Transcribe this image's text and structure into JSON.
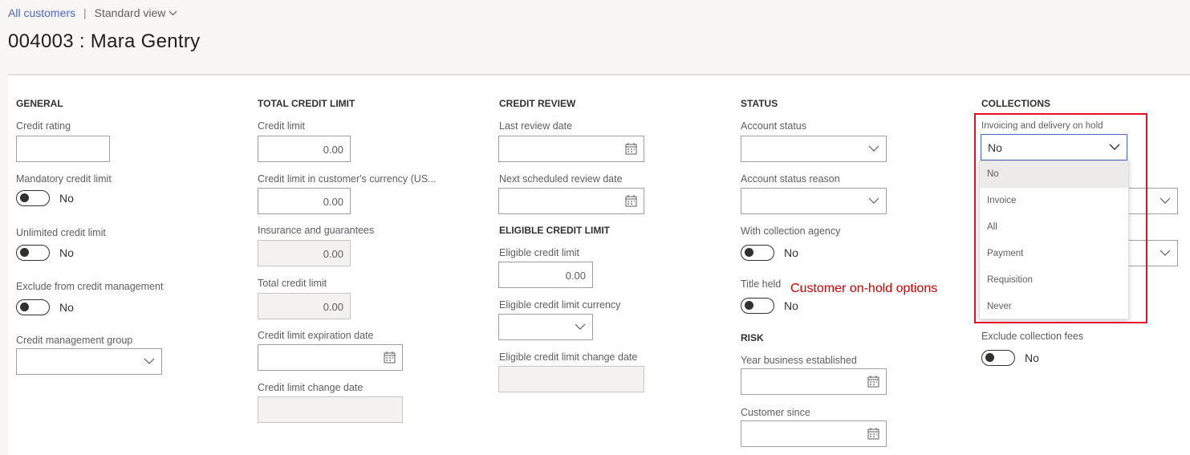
{
  "breadcrumb": {
    "link": "All customers",
    "separator": "|",
    "view": "Standard view"
  },
  "title": "004003 : Mara Gentry",
  "sections": {
    "general": {
      "title": "GENERAL",
      "credit_rating_label": "Credit rating",
      "mandatory_label": "Mandatory credit limit",
      "mandatory_value": "No",
      "unlimited_label": "Unlimited credit limit",
      "unlimited_value": "No",
      "exclude_label": "Exclude from credit management",
      "exclude_value": "No",
      "group_label": "Credit management group"
    },
    "total_credit_limit": {
      "title": "TOTAL CREDIT LIMIT",
      "credit_limit_label": "Credit limit",
      "credit_limit_value": "0.00",
      "currency_label": "Credit limit in customer's currency (US...",
      "currency_value": "0.00",
      "insurance_label": "Insurance and guarantees",
      "insurance_value": "0.00",
      "total_label": "Total credit limit",
      "total_value": "0.00",
      "expiration_label": "Credit limit expiration date",
      "change_date_label": "Credit limit change date"
    },
    "credit_review": {
      "title": "CREDIT REVIEW",
      "last_review_label": "Last review date",
      "next_review_label": "Next scheduled review date"
    },
    "eligible_credit_limit": {
      "title": "ELIGIBLE CREDIT LIMIT",
      "limit_label": "Eligible credit limit",
      "limit_value": "0.00",
      "currency_label": "Eligible credit limit currency",
      "change_date_label": "Eligible credit limit change date"
    },
    "status": {
      "title": "STATUS",
      "account_status_label": "Account status",
      "account_status_reason_label": "Account status reason",
      "collection_agency_label": "With collection agency",
      "collection_agency_value": "No",
      "title_held_label": "Title held",
      "title_held_value": "No"
    },
    "risk": {
      "title": "RISK",
      "year_established_label": "Year business established",
      "customer_since_label": "Customer since"
    },
    "collections": {
      "title": "COLLECTIONS",
      "on_hold_label": "Invoicing and delivery on hold",
      "on_hold_value": "No",
      "on_hold_options": [
        "No",
        "Invoice",
        "All",
        "Payment",
        "Requisition",
        "Never"
      ],
      "exclude_fees_label": "Exclude collection fees",
      "exclude_fees_value": "No"
    }
  },
  "annotation": "Customer on-hold options",
  "colors": {
    "link": "#4a67c2",
    "highlight": "#e81123",
    "annotation": "#d40000"
  },
  "icons": [
    "chevron-down-icon",
    "calendar-icon",
    "toggle-switch"
  ]
}
